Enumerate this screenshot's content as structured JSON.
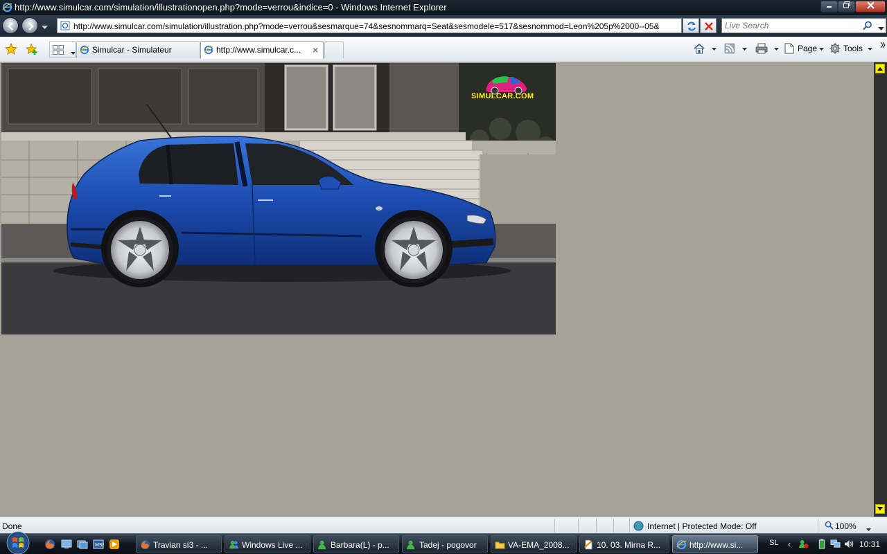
{
  "window": {
    "title": "http://www.simulcar.com/simulation/illustrationopen.php?mode=verrou&indice=0 - Windows Internet Explorer",
    "controls": [
      "minimize",
      "maximize",
      "close"
    ]
  },
  "address_bar": {
    "url": "http://www.simulcar.com/simulation/illustration.php?mode=verrou&sesmarque=74&sesnommarq=Seat&sesmodele=517&sesnommod=Leon%205p%2000--05&",
    "search_placeholder": "Live Search"
  },
  "tabs": [
    {
      "label": "Simulcar - Simulateur",
      "active": false
    },
    {
      "label": "http://www.simulcar.c...",
      "active": true
    }
  ],
  "commands": {
    "page_label": "Page",
    "tools_label": "Tools"
  },
  "content": {
    "logo_text": "SIMULCAR.COM",
    "background_color": "#a5a398",
    "car_color": "#1d4fb5"
  },
  "status_bar": {
    "status": "Done",
    "zone": "Internet | Protected Mode: Off",
    "zoom": "100%"
  },
  "taskbar": {
    "items": [
      {
        "label": "Travian si3 - ...",
        "icon": "firefox-icon",
        "active": false
      },
      {
        "label": "Windows Live ...",
        "icon": "messenger-icon",
        "active": false
      },
      {
        "label": "Barbara(L) - p...",
        "icon": "messenger-icon",
        "active": false
      },
      {
        "label": "Tadej - pogovor",
        "icon": "messenger-icon",
        "active": false
      },
      {
        "label": "VA-EMA_2008...",
        "icon": "folder-icon",
        "active": false
      },
      {
        "label": "10. 03. Mirna R...",
        "icon": "document-icon",
        "active": false
      },
      {
        "label": "http://www.si...",
        "icon": "ie-icon",
        "active": true
      }
    ],
    "language": "SL",
    "clock": "10:31"
  }
}
